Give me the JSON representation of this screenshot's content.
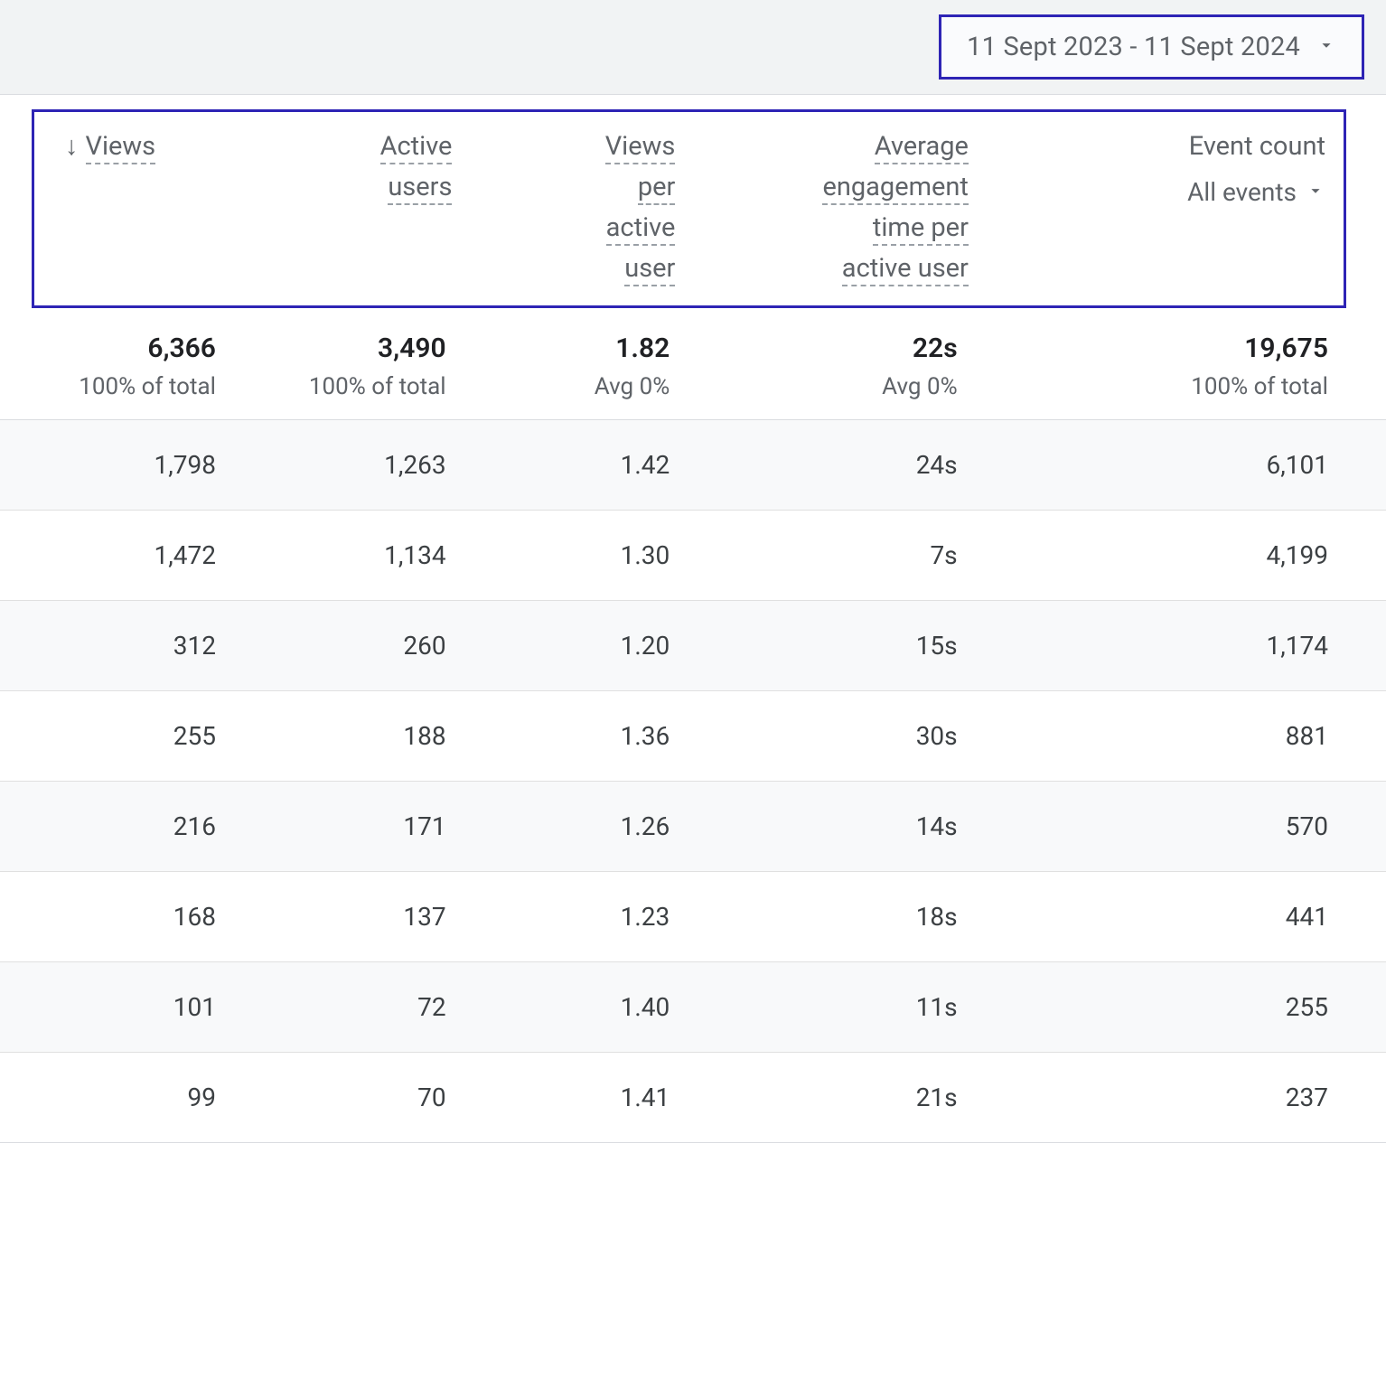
{
  "dateRange": {
    "label": "11 Sept 2023 - 11 Sept 2024"
  },
  "columns": {
    "views": {
      "label": "Views",
      "sort_indicator": "↓"
    },
    "active_users": {
      "l1": "Active",
      "l2": "users"
    },
    "views_per_active": {
      "l1": "Views",
      "l2": "per",
      "l3": "active",
      "l4": "user"
    },
    "avg_engagement": {
      "l1": "Average",
      "l2": "engagement",
      "l3": "time per",
      "l4": "active user"
    },
    "event_count": {
      "label": "Event count",
      "filter_label": "All events"
    }
  },
  "totals": {
    "views": {
      "num": "6,366",
      "sub": "100% of total"
    },
    "active_users": {
      "num": "3,490",
      "sub": "100% of total"
    },
    "views_per_active": {
      "num": "1.82",
      "sub": "Avg 0%"
    },
    "avg_engagement": {
      "num": "22s",
      "sub": "Avg 0%"
    },
    "event_count": {
      "num": "19,675",
      "sub": "100% of total"
    }
  },
  "rows": [
    {
      "views": "1,798",
      "active_users": "1,263",
      "views_per_active": "1.42",
      "avg_engagement": "24s",
      "event_count": "6,101"
    },
    {
      "views": "1,472",
      "active_users": "1,134",
      "views_per_active": "1.30",
      "avg_engagement": "7s",
      "event_count": "4,199"
    },
    {
      "views": "312",
      "active_users": "260",
      "views_per_active": "1.20",
      "avg_engagement": "15s",
      "event_count": "1,174"
    },
    {
      "views": "255",
      "active_users": "188",
      "views_per_active": "1.36",
      "avg_engagement": "30s",
      "event_count": "881"
    },
    {
      "views": "216",
      "active_users": "171",
      "views_per_active": "1.26",
      "avg_engagement": "14s",
      "event_count": "570"
    },
    {
      "views": "168",
      "active_users": "137",
      "views_per_active": "1.23",
      "avg_engagement": "18s",
      "event_count": "441"
    },
    {
      "views": "101",
      "active_users": "72",
      "views_per_active": "1.40",
      "avg_engagement": "11s",
      "event_count": "255"
    },
    {
      "views": "99",
      "active_users": "70",
      "views_per_active": "1.41",
      "avg_engagement": "21s",
      "event_count": "237"
    }
  ]
}
